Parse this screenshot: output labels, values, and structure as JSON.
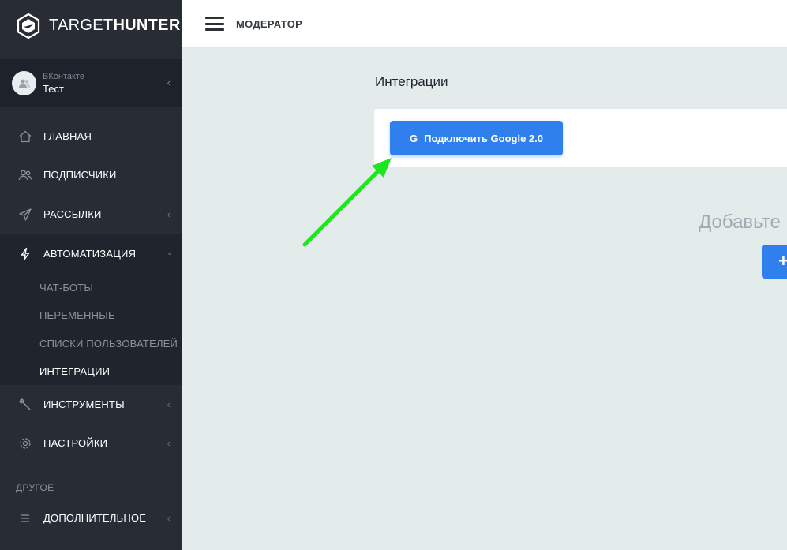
{
  "brand": {
    "part1": "TARGET",
    "part2": "HUNTER"
  },
  "account": {
    "network": "ВКонтакте",
    "name": "Тест"
  },
  "menu": {
    "items": [
      {
        "label": "ГЛАВНАЯ",
        "icon": "home-icon"
      },
      {
        "label": "ПОДПИСЧИКИ",
        "icon": "users-icon"
      },
      {
        "label": "РАССЫЛКИ",
        "icon": "send-icon"
      },
      {
        "label": "АВТОМАТИЗАЦИЯ",
        "icon": "bolt-icon"
      },
      {
        "label": "ИНСТРУМЕНТЫ",
        "icon": "wrench-icon"
      },
      {
        "label": "НАСТРОЙКИ",
        "icon": "gear-icon"
      },
      {
        "label": "ДОПОЛНИТЕЛЬНОЕ",
        "icon": "list-icon"
      }
    ],
    "submenu": [
      "ЧАТ-БОТЫ",
      "ПЕРЕМЕННЫЕ",
      "СПИСКИ ПОЛЬЗОВАТЕЛЕЙ",
      "ИНТЕГРАЦИИ"
    ],
    "section_label": "ДРУГОЕ"
  },
  "topbar": {
    "title": "МОДЕРАТОР"
  },
  "content": {
    "page_title": "Интеграции",
    "google_button": "Подключить Google 2.0",
    "google_icon": "G",
    "empty_text": "Добавьте",
    "add_button": "+"
  },
  "colors": {
    "accent": "#2f80ed",
    "sidebar": "#272c35",
    "arrow": "#1ee61e"
  }
}
